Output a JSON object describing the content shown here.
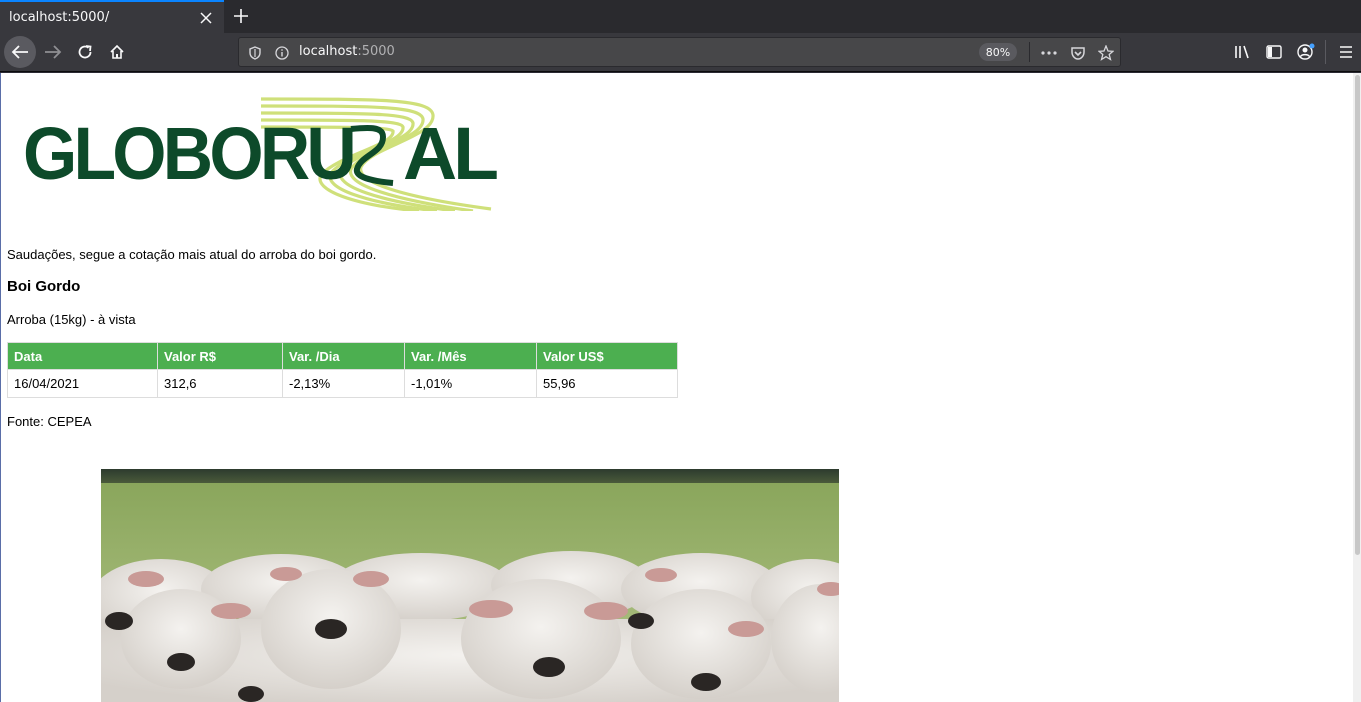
{
  "browser": {
    "tab_title": "localhost:5000/",
    "url_host": "localhost",
    "url_port": ":5000",
    "zoom": "80%"
  },
  "page": {
    "logo_text": "GLOBORURAL",
    "greeting": "Saudações, segue a cotação mais atual do arroba do boi gordo.",
    "section_title": "Boi Gordo",
    "subtitle": "Arroba (15kg) - à vista",
    "table": {
      "headers": [
        "Data",
        "Valor R$",
        "Var. /Dia",
        "Var. /Mês",
        "Valor US$"
      ],
      "rows": [
        [
          "16/04/2021",
          "312,6",
          "-2,13%",
          "-1,01%",
          "55,96"
        ]
      ]
    },
    "source": "Fonte: CEPEA"
  },
  "colors": {
    "table_header": "#4caf50",
    "logo_dark_green": "#0d4a2a",
    "logo_light_green": "#cfe07a"
  }
}
